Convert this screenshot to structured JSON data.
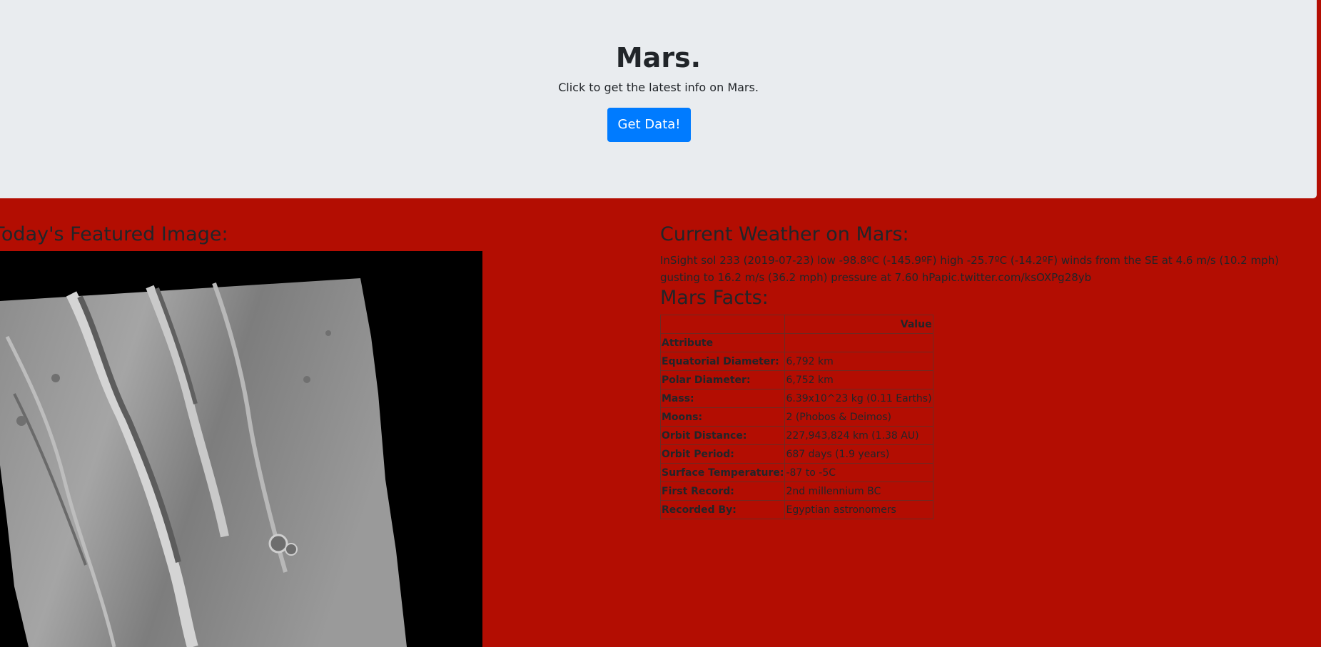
{
  "jumbotron": {
    "title": "Mars.",
    "subtitle": "Click to get the latest info on Mars.",
    "button_label": "Get Data!"
  },
  "featured": {
    "heading": "Today's Featured Image:"
  },
  "weather": {
    "heading": "Current Weather on Mars:",
    "text": "InSight sol 233 (2019-07-23) low -98.8ºC (-145.9ºF) high -25.7ºC (-14.2ºF) winds from the SE at 4.6 m/s (10.2 mph) gusting to 16.2 m/s (36.2 mph) pressure at 7.60 hPapic.twitter.com/ksOXPg28yb"
  },
  "facts": {
    "heading": "Mars Facts:",
    "column_header": "Value",
    "index_label": "Attribute",
    "rows": [
      {
        "attribute": "Equatorial Diameter:",
        "value": "6,792 km"
      },
      {
        "attribute": "Polar Diameter:",
        "value": "6,752 km"
      },
      {
        "attribute": "Mass:",
        "value": "6.39x10^23 kg (0.11 Earths)"
      },
      {
        "attribute": "Moons:",
        "value": "2 (Phobos & Deimos)"
      },
      {
        "attribute": "Orbit Distance:",
        "value": "227,943,824 km (1.38 AU)"
      },
      {
        "attribute": "Orbit Period:",
        "value": "687 days (1.9 years)"
      },
      {
        "attribute": "Surface Temperature:",
        "value": "-87 to -5C"
      },
      {
        "attribute": "First Record:",
        "value": "2nd millennium BC"
      },
      {
        "attribute": "Recorded By:",
        "value": "Egyptian astronomers"
      }
    ]
  },
  "colors": {
    "page_background": "#b30d02",
    "jumbotron_background": "#e9ecef",
    "button": "#007bff"
  }
}
